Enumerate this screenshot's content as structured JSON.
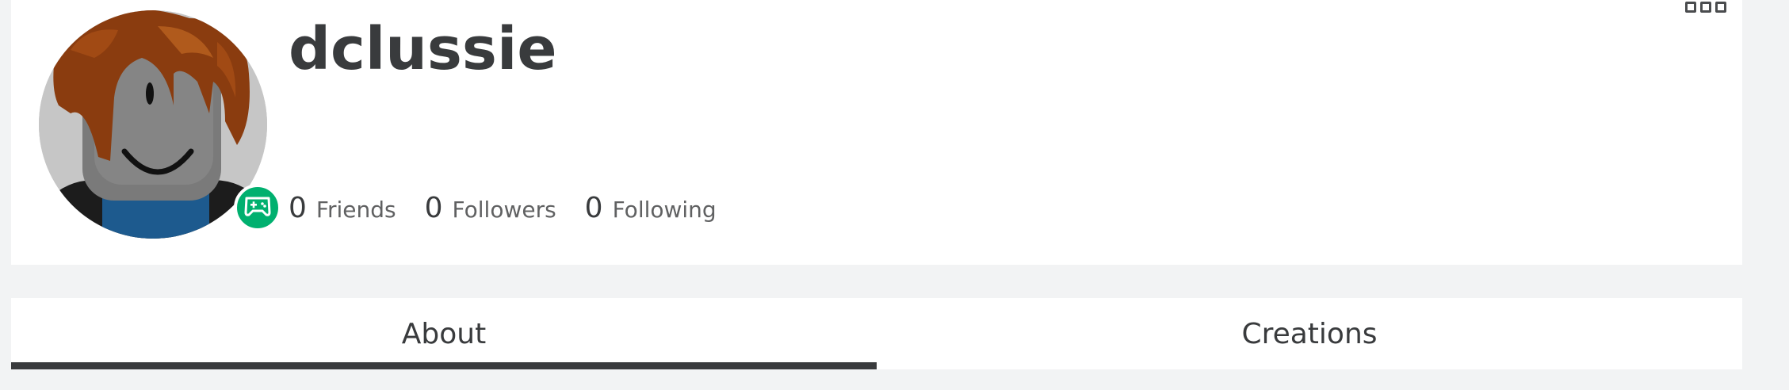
{
  "profile": {
    "username": "dclussie",
    "presence": "in-game",
    "avatar_alt": "avatar"
  },
  "stats": [
    {
      "count": "0",
      "label": "Friends"
    },
    {
      "count": "0",
      "label": "Followers"
    },
    {
      "count": "0",
      "label": "Following"
    }
  ],
  "tabs": [
    {
      "label": "About",
      "active": true
    },
    {
      "label": "Creations",
      "active": false
    }
  ],
  "icons": {
    "more": "more-options-icon",
    "presence": "gamepad-icon"
  },
  "colors": {
    "presence_green": "#00b06f",
    "text_dark": "#393b3d",
    "page_bg": "#f2f3f4"
  }
}
